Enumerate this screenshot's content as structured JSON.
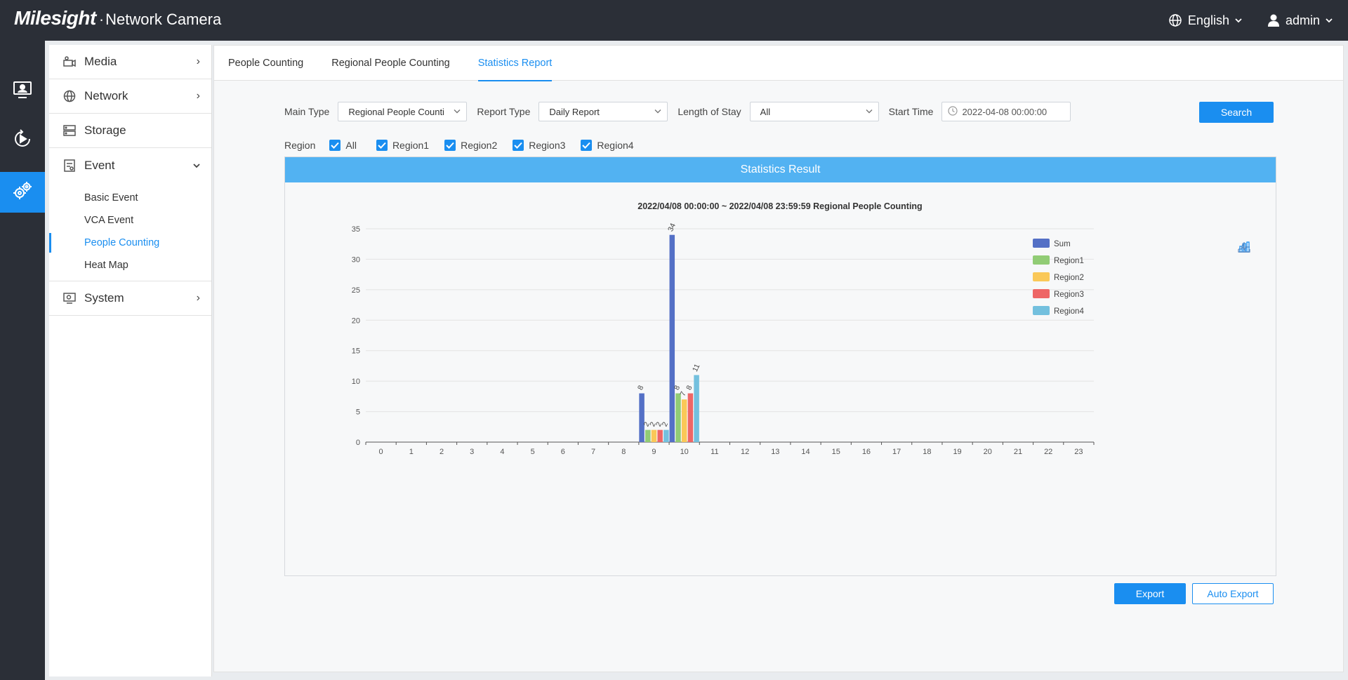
{
  "header": {
    "brand": "Milesight",
    "separator": "·",
    "product": "Network Camera",
    "language": "English",
    "user": "admin"
  },
  "rail": {
    "items": [
      {
        "icon": "monitor-person-icon",
        "active": false
      },
      {
        "icon": "playback-icon",
        "active": false
      },
      {
        "icon": "settings-gears-icon",
        "active": true
      }
    ]
  },
  "menu": {
    "items": [
      {
        "label": "Media",
        "icon": "camera-icon",
        "chevron": "›"
      },
      {
        "label": "Network",
        "icon": "globe-icon",
        "chevron": "›"
      },
      {
        "label": "Storage",
        "icon": "storage-icon",
        "chevron": ""
      },
      {
        "label": "Event",
        "icon": "event-icon",
        "chevron": "⌄"
      },
      {
        "label": "System",
        "icon": "system-icon",
        "chevron": "›"
      }
    ],
    "event_sub": [
      "Basic Event",
      "VCA Event",
      "People Counting",
      "Heat Map"
    ],
    "active_sub": "People Counting"
  },
  "tabs": [
    "People Counting",
    "Regional People Counting",
    "Statistics Report"
  ],
  "active_tab": "Statistics Report",
  "filters": {
    "main_type_label": "Main Type",
    "main_type_value": "Regional People Counti",
    "report_type_label": "Report Type",
    "report_type_value": "Daily Report",
    "length_of_stay_label": "Length of Stay",
    "length_of_stay_value": "All",
    "start_time_label": "Start Time",
    "start_time_value": "2022-04-08 00:00:00",
    "search_label": "Search"
  },
  "regions": {
    "label": "Region",
    "options": [
      {
        "label": "All",
        "checked": true
      },
      {
        "label": "Region1",
        "checked": true
      },
      {
        "label": "Region2",
        "checked": true
      },
      {
        "label": "Region3",
        "checked": true
      },
      {
        "label": "Region4",
        "checked": true
      }
    ]
  },
  "result": {
    "header": "Statistics Result",
    "export_label": "Export",
    "auto_export_label": "Auto Export"
  },
  "colors": {
    "accent": "#1a8ef0",
    "sum": "#5470c6",
    "region1": "#91cc75",
    "region2": "#fac858",
    "region3": "#ee6666",
    "region4": "#73c0de"
  },
  "chart_data": {
    "type": "bar",
    "title": "2022/04/08 00:00:00  ~  2022/04/08 23:59:59 Regional People Counting",
    "categories": [
      "0",
      "1",
      "2",
      "3",
      "4",
      "5",
      "6",
      "7",
      "8",
      "9",
      "10",
      "11",
      "12",
      "13",
      "14",
      "15",
      "16",
      "17",
      "18",
      "19",
      "20",
      "21",
      "22",
      "23"
    ],
    "ylim": [
      0,
      35
    ],
    "yticks": [
      0,
      5,
      10,
      15,
      20,
      25,
      30,
      35
    ],
    "legend_position": "right",
    "series": [
      {
        "name": "Sum",
        "color": "#5470c6",
        "values": [
          0,
          0,
          0,
          0,
          0,
          0,
          0,
          0,
          0,
          8,
          34,
          0,
          0,
          0,
          0,
          0,
          0,
          0,
          0,
          0,
          0,
          0,
          0,
          0
        ]
      },
      {
        "name": "Region1",
        "color": "#91cc75",
        "values": [
          0,
          0,
          0,
          0,
          0,
          0,
          0,
          0,
          0,
          2,
          8,
          0,
          0,
          0,
          0,
          0,
          0,
          0,
          0,
          0,
          0,
          0,
          0,
          0
        ]
      },
      {
        "name": "Region2",
        "color": "#fac858",
        "values": [
          0,
          0,
          0,
          0,
          0,
          0,
          0,
          0,
          0,
          2,
          7,
          0,
          0,
          0,
          0,
          0,
          0,
          0,
          0,
          0,
          0,
          0,
          0,
          0
        ]
      },
      {
        "name": "Region3",
        "color": "#ee6666",
        "values": [
          0,
          0,
          0,
          0,
          0,
          0,
          0,
          0,
          0,
          2,
          8,
          0,
          0,
          0,
          0,
          0,
          0,
          0,
          0,
          0,
          0,
          0,
          0,
          0
        ]
      },
      {
        "name": "Region4",
        "color": "#73c0de",
        "values": [
          0,
          0,
          0,
          0,
          0,
          0,
          0,
          0,
          0,
          2,
          11,
          0,
          0,
          0,
          0,
          0,
          0,
          0,
          0,
          0,
          0,
          0,
          0,
          0
        ]
      }
    ]
  }
}
